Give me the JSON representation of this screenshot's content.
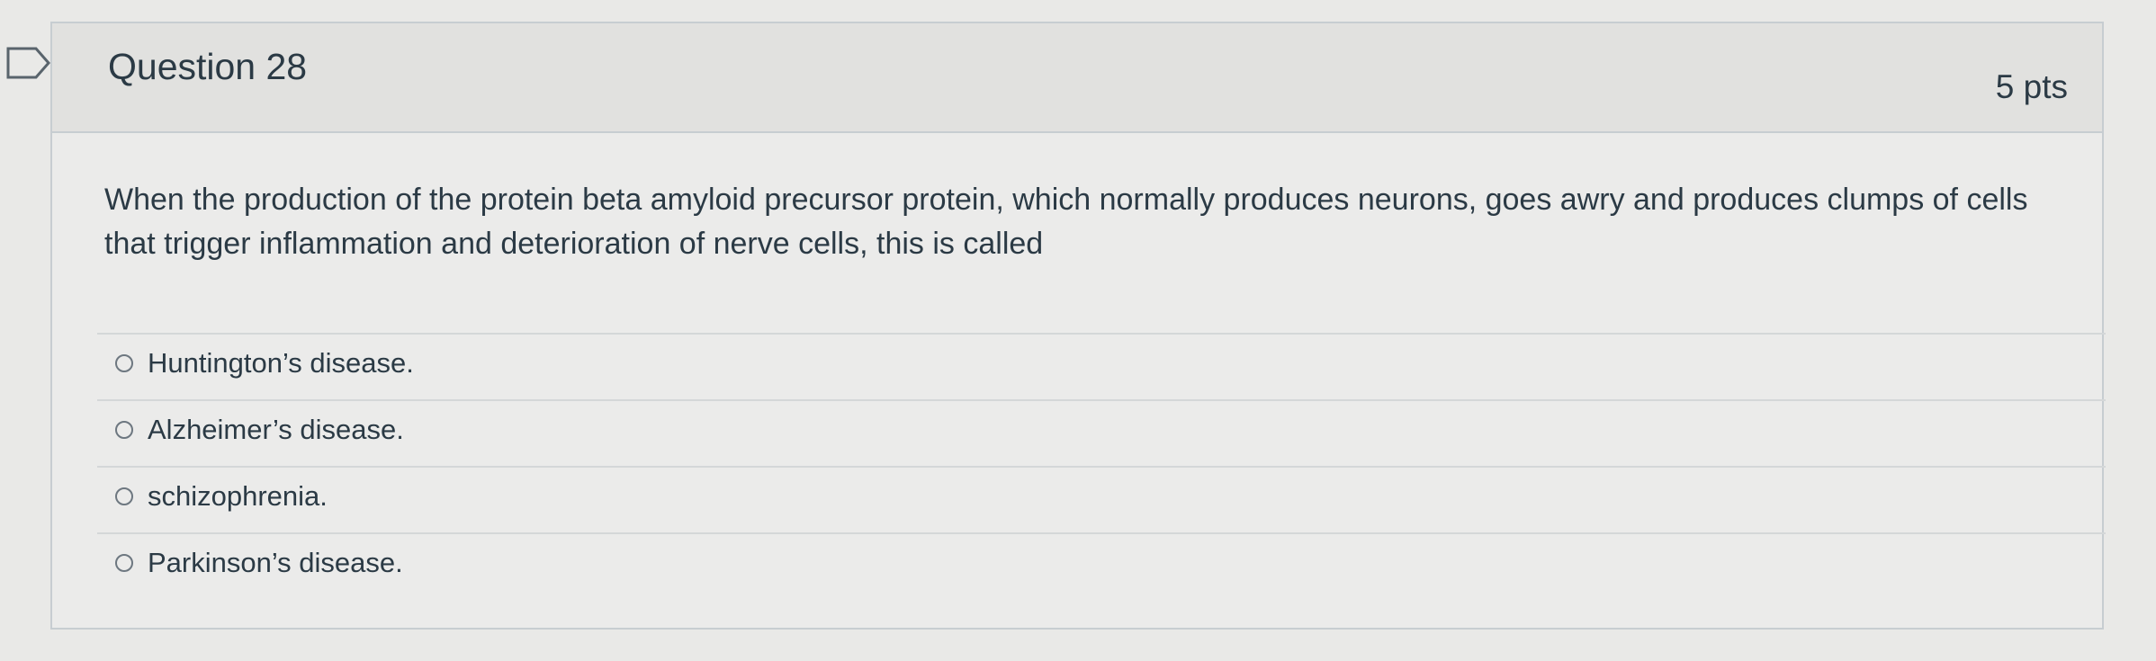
{
  "question": {
    "title": "Question 28",
    "points": "5 pts",
    "text": "When the production of the protein beta amyloid precursor protein, which normally produces neurons, goes awry and produces clumps of cells that trigger inflammation and deterioration of nerve cells, this is called"
  },
  "answers": [
    {
      "label": "Huntington’s disease."
    },
    {
      "label": "Alzheimer’s disease."
    },
    {
      "label": "schizophrenia."
    },
    {
      "label": "Parkinson’s disease."
    }
  ],
  "icons": {
    "flag": "bookmark-flag-icon"
  }
}
